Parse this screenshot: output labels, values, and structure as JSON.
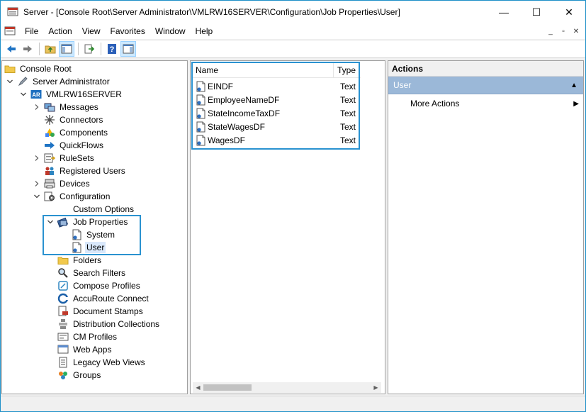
{
  "window": {
    "title": "Server - [Console Root\\Server Administrator\\VMLRW16SERVER\\Configuration\\Job Properties\\User]",
    "minimize": "—",
    "maximize": "☐",
    "close": "✕"
  },
  "menu": {
    "items": [
      "File",
      "Action",
      "View",
      "Favorites",
      "Window",
      "Help"
    ],
    "mdi_minimize": "_",
    "mdi_restore": "▫",
    "mdi_close": "✕"
  },
  "toolbar": {
    "icons": [
      "back-arrow-icon",
      "forward-arrow-icon",
      "up-folder-icon",
      "show-hide-tree-icon",
      "export-list-icon",
      "help-icon",
      "show-hide-action-pane-icon"
    ]
  },
  "tree": {
    "items": [
      {
        "label": "Console Root",
        "icon": "folder-icon",
        "level": 0,
        "expander": ""
      },
      {
        "label": "Server Administrator",
        "icon": "pen-icon",
        "level": 1,
        "expander": "v"
      },
      {
        "label": "VMLRW16SERVER",
        "icon": "ar-server-icon",
        "level": 2,
        "expander": "v"
      },
      {
        "label": "Messages",
        "icon": "messages-icon",
        "level": 3,
        "expander": ">"
      },
      {
        "label": "Connectors",
        "icon": "connectors-icon",
        "level": 3,
        "expander": ""
      },
      {
        "label": "Components",
        "icon": "components-icon",
        "level": 3,
        "expander": ""
      },
      {
        "label": "QuickFlows",
        "icon": "quickflows-arrow-icon",
        "level": 3,
        "expander": ""
      },
      {
        "label": "RuleSets",
        "icon": "rulesets-icon",
        "level": 3,
        "expander": ">"
      },
      {
        "label": "Registered Users",
        "icon": "users-icon",
        "level": 3,
        "expander": ""
      },
      {
        "label": "Devices",
        "icon": "devices-icon",
        "level": 3,
        "expander": ">"
      },
      {
        "label": "Configuration",
        "icon": "configuration-icon",
        "level": 3,
        "expander": "v"
      },
      {
        "label": "Custom Options",
        "icon": "custom-options-icon",
        "level": 4,
        "expander": ""
      },
      {
        "label": "Job Properties",
        "icon": "job-properties-icon",
        "level": 4,
        "expander": "v"
      },
      {
        "label": "System",
        "icon": "property-page-icon",
        "level": 5,
        "expander": ""
      },
      {
        "label": "User",
        "icon": "property-page-icon",
        "level": 5,
        "expander": "",
        "selected": true
      },
      {
        "label": "Folders",
        "icon": "folder-icon",
        "level": 4,
        "expander": ""
      },
      {
        "label": "Search Filters",
        "icon": "search-filters-icon",
        "level": 4,
        "expander": ""
      },
      {
        "label": "Compose Profiles",
        "icon": "compose-profiles-icon",
        "level": 4,
        "expander": ""
      },
      {
        "label": "AccuRoute Connect",
        "icon": "accuroute-connect-icon",
        "level": 4,
        "expander": ""
      },
      {
        "label": "Document Stamps",
        "icon": "document-stamps-icon",
        "level": 4,
        "expander": ""
      },
      {
        "label": "Distribution Collections",
        "icon": "distribution-collections-icon",
        "level": 4,
        "expander": ""
      },
      {
        "label": "CM Profiles",
        "icon": "cm-profiles-icon",
        "level": 4,
        "expander": ""
      },
      {
        "label": "Web Apps",
        "icon": "web-apps-icon",
        "level": 4,
        "expander": ""
      },
      {
        "label": "Legacy Web Views",
        "icon": "legacy-web-views-icon",
        "level": 4,
        "expander": ""
      },
      {
        "label": "Groups",
        "icon": "groups-icon",
        "level": 4,
        "expander": ""
      }
    ]
  },
  "list": {
    "columns": [
      "Name",
      "Type"
    ],
    "rows": [
      {
        "name": "EINDF",
        "type": "Text"
      },
      {
        "name": "EmployeeNameDF",
        "type": "Text"
      },
      {
        "name": "StateIncomeTaxDF",
        "type": "Text"
      },
      {
        "name": "StateWagesDF",
        "type": "Text"
      },
      {
        "name": "WagesDF",
        "type": "Text"
      }
    ]
  },
  "actions": {
    "header": "Actions",
    "section": "User",
    "items": [
      "More Actions"
    ]
  },
  "colors": {
    "accent": "#2a92d0",
    "selection": "#d9e8fb",
    "actions_section": "#9bb8d8"
  }
}
